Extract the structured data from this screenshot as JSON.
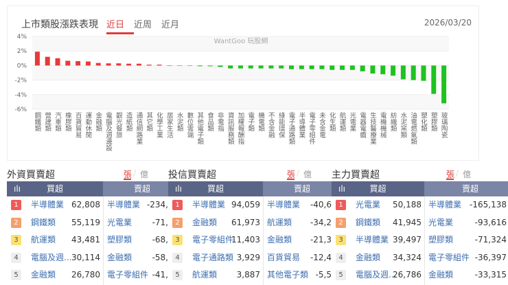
{
  "header": {
    "title": "上市類股漲跌表現",
    "tabs": [
      "近日",
      "近周",
      "近月"
    ],
    "date": "2026/03/20"
  },
  "chart_data": {
    "type": "bar",
    "title": "上市類股漲跌表現",
    "watermark": "WantGoo 玩股網",
    "ylim": [
      -6,
      4
    ],
    "yticks": [
      "4%",
      "2%",
      "0%",
      "-2%",
      "-4%",
      "-6%"
    ],
    "ytick_values": [
      4,
      2,
      0,
      -2,
      -4,
      -6
    ],
    "categories": [
      "鋼鐵類",
      "營建類",
      "汽車類",
      "橡膠類",
      "百貨貿易",
      "運動休閒",
      "金融類",
      "電腦及週邊設",
      "觀光餐旅",
      "造紙類",
      "通信網路業",
      "其它類",
      "化學工業",
      "居家生活",
      "水泥類",
      "數位雲端",
      "其他電子類",
      "食品類",
      "非電指",
      "資訊服務類",
      "加權報酬指",
      "電子類",
      "機電類",
      "不含金融",
      "綠能環保",
      "電子通路類",
      "半導體業",
      "電子零組件",
      "未含金電",
      "化生類",
      "航運類",
      "光電業",
      "電器電纜",
      "生技醫療業",
      "電機機械",
      "紡織類",
      "水泥窯類",
      "油電燃氣類",
      "塑化類",
      "塑膠類",
      "玻璃陶瓷"
    ],
    "values": [
      1.9,
      1.2,
      1.0,
      0.65,
      0.6,
      0.55,
      0.35,
      0.3,
      0.3,
      0.25,
      0.25,
      0.12,
      0.12,
      0,
      -0.05,
      -0.05,
      -0.1,
      -0.1,
      -0.2,
      -0.4,
      -0.4,
      -0.4,
      -0.4,
      -0.4,
      -0.4,
      -0.5,
      -0.5,
      -0.5,
      -0.5,
      -0.6,
      -0.6,
      -0.6,
      -0.8,
      -1.1,
      -1.2,
      -1.4,
      -1.9,
      -2.0,
      -2.1,
      -3.9,
      -5.2
    ],
    "colors": {
      "up": "#e63a3a",
      "down": "#1fc21f"
    }
  },
  "panels": [
    {
      "title": "外資買賣超",
      "unit_on": "張",
      "unit_off": "億",
      "buy_label": "買超",
      "sell_label": "賣超",
      "buy": [
        {
          "rank": "1",
          "name": "半導體業",
          "value": "62,808"
        },
        {
          "rank": "2",
          "name": "鋼鐵類",
          "value": "55,119"
        },
        {
          "rank": "3",
          "name": "航運類",
          "value": "43,481"
        },
        {
          "rank": "4",
          "name": "電腦及週...",
          "value": "30,114"
        },
        {
          "rank": "5",
          "name": "金融類",
          "value": "26,780"
        }
      ],
      "sell": [
        {
          "name": "半導體業",
          "value": "-234,"
        },
        {
          "name": "光電業",
          "value": "-71,"
        },
        {
          "name": "塑膠類",
          "value": "-68,"
        },
        {
          "name": "金融類",
          "value": "-58,"
        },
        {
          "name": "電子零組件",
          "value": "-41,"
        }
      ]
    },
    {
      "title": "投信買賣超",
      "unit_on": "張",
      "unit_off": "億",
      "buy_label": "買超",
      "sell_label": "賣超",
      "buy": [
        {
          "rank": "1",
          "name": "半導體業",
          "value": "94,059"
        },
        {
          "rank": "2",
          "name": "金融類",
          "value": "61,973"
        },
        {
          "rank": "3",
          "name": "電子零組件",
          "value": "11,403"
        },
        {
          "rank": "4",
          "name": "電子通路類",
          "value": "3,929"
        },
        {
          "rank": "5",
          "name": "航運類",
          "value": "3,887"
        }
      ],
      "sell": [
        {
          "name": "半導體業",
          "value": "-40,6"
        },
        {
          "name": "航運類",
          "value": "-34,2"
        },
        {
          "name": "金融類",
          "value": "-21,3"
        },
        {
          "name": "百貨貿易",
          "value": "-12,4"
        },
        {
          "name": "其他電子類",
          "value": "-5,5"
        }
      ]
    },
    {
      "title": "主力買賣超",
      "unit_on": "張",
      "unit_off": "億",
      "buy_label": "買超",
      "sell_label": "賣超",
      "buy": [
        {
          "rank": "1",
          "name": "光電業",
          "value": "50,188"
        },
        {
          "rank": "2",
          "name": "鋼鐵類",
          "value": "41,945"
        },
        {
          "rank": "3",
          "name": "半導體業",
          "value": "39,497"
        },
        {
          "rank": "4",
          "name": "金融類",
          "value": "34,324"
        },
        {
          "rank": "5",
          "name": "電腦及週...",
          "value": "26,786"
        }
      ],
      "sell": [
        {
          "name": "半導體業",
          "value": "-165,138"
        },
        {
          "name": "光電業",
          "value": "-93,616"
        },
        {
          "name": "塑膠類",
          "value": "-71,324"
        },
        {
          "name": "電子零組件",
          "value": "-36,397"
        },
        {
          "name": "金融類",
          "value": "-33,315"
        }
      ]
    }
  ]
}
